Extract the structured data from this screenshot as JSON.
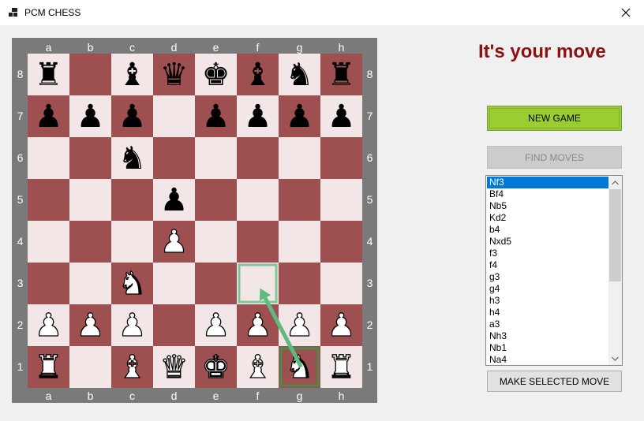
{
  "window": {
    "title": "PCM CHESS",
    "icon": "app-window-icon",
    "close_icon": "close-icon"
  },
  "board": {
    "files": [
      "a",
      "b",
      "c",
      "d",
      "e",
      "f",
      "g",
      "h"
    ],
    "ranks": [
      "8",
      "7",
      "6",
      "5",
      "4",
      "3",
      "2",
      "1"
    ],
    "light_color": "#f2e6e6",
    "dark_color": "#9e4f4f",
    "frame_color": "#7a7a7a",
    "pieces": [
      {
        "square": "a8",
        "color": "black",
        "type": "rook",
        "glyph": "♜"
      },
      {
        "square": "c8",
        "color": "black",
        "type": "bishop",
        "glyph": "♝"
      },
      {
        "square": "d8",
        "color": "black",
        "type": "queen",
        "glyph": "♛"
      },
      {
        "square": "e8",
        "color": "black",
        "type": "king",
        "glyph": "♚"
      },
      {
        "square": "f8",
        "color": "black",
        "type": "bishop",
        "glyph": "♝"
      },
      {
        "square": "g8",
        "color": "black",
        "type": "knight",
        "glyph": "♞"
      },
      {
        "square": "h8",
        "color": "black",
        "type": "rook",
        "glyph": "♜"
      },
      {
        "square": "a7",
        "color": "black",
        "type": "pawn",
        "glyph": "♟"
      },
      {
        "square": "b7",
        "color": "black",
        "type": "pawn",
        "glyph": "♟"
      },
      {
        "square": "c7",
        "color": "black",
        "type": "pawn",
        "glyph": "♟"
      },
      {
        "square": "e7",
        "color": "black",
        "type": "pawn",
        "glyph": "♟"
      },
      {
        "square": "f7",
        "color": "black",
        "type": "pawn",
        "glyph": "♟"
      },
      {
        "square": "g7",
        "color": "black",
        "type": "pawn",
        "glyph": "♟"
      },
      {
        "square": "h7",
        "color": "black",
        "type": "pawn",
        "glyph": "♟"
      },
      {
        "square": "c6",
        "color": "black",
        "type": "knight",
        "glyph": "♞"
      },
      {
        "square": "d5",
        "color": "black",
        "type": "pawn",
        "glyph": "♟"
      },
      {
        "square": "d4",
        "color": "white",
        "type": "pawn",
        "glyph": "♟"
      },
      {
        "square": "c3",
        "color": "white",
        "type": "knight",
        "glyph": "♞"
      },
      {
        "square": "a2",
        "color": "white",
        "type": "pawn",
        "glyph": "♟"
      },
      {
        "square": "b2",
        "color": "white",
        "type": "pawn",
        "glyph": "♟"
      },
      {
        "square": "c2",
        "color": "white",
        "type": "pawn",
        "glyph": "♟"
      },
      {
        "square": "e2",
        "color": "white",
        "type": "pawn",
        "glyph": "♟"
      },
      {
        "square": "f2",
        "color": "white",
        "type": "pawn",
        "glyph": "♟"
      },
      {
        "square": "g2",
        "color": "white",
        "type": "pawn",
        "glyph": "♟"
      },
      {
        "square": "h2",
        "color": "white",
        "type": "pawn",
        "glyph": "♟"
      },
      {
        "square": "a1",
        "color": "white",
        "type": "rook",
        "glyph": "♜"
      },
      {
        "square": "c1",
        "color": "white",
        "type": "bishop",
        "glyph": "♝"
      },
      {
        "square": "d1",
        "color": "white",
        "type": "queen",
        "glyph": "♛"
      },
      {
        "square": "e1",
        "color": "white",
        "type": "king",
        "glyph": "♚"
      },
      {
        "square": "f1",
        "color": "white",
        "type": "bishop",
        "glyph": "♝"
      },
      {
        "square": "g1",
        "color": "white",
        "type": "knight",
        "glyph": "♞"
      },
      {
        "square": "h1",
        "color": "white",
        "type": "rook",
        "glyph": "♜"
      }
    ],
    "move_hint": {
      "from": "g1",
      "to": "f3",
      "from_color": "#4a8a4a",
      "to_color": "#7fc79a",
      "arrow_color": "#5fba80"
    }
  },
  "status_text": "It's your move",
  "status_color": "#8b1212",
  "buttons": {
    "new_game": "NEW GAME",
    "find_moves": "FIND MOVES",
    "make_move": "MAKE SELECTED MOVE"
  },
  "moves": {
    "selected_index": 0,
    "items": [
      "Nf3",
      "Bf4",
      "Nb5",
      "Kd2",
      "b4",
      "Nxd5",
      "f3",
      "f4",
      "g3",
      "g4",
      "h3",
      "h4",
      "a3",
      "Nh3",
      "Nb1",
      "Na4"
    ]
  }
}
